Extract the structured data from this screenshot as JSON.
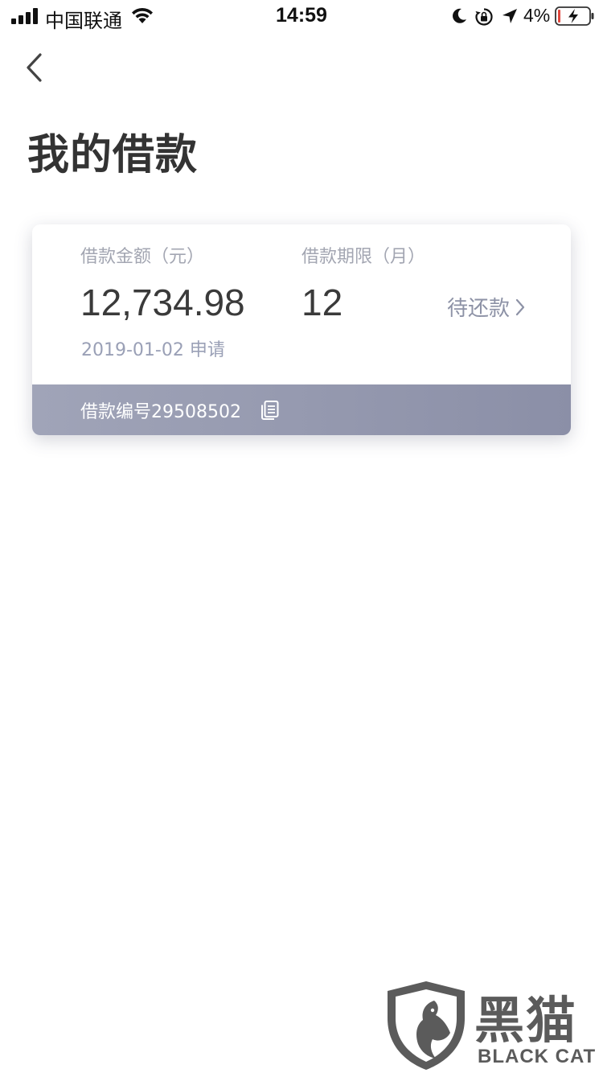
{
  "status_bar": {
    "carrier": "中国联通",
    "time": "14:59",
    "battery_percent": "4%"
  },
  "header": {
    "title": "我的借款"
  },
  "loan_card": {
    "amount_label": "借款金额（元）",
    "amount_value": "12,734.98",
    "term_label": "借款期限（月）",
    "term_value": "12",
    "apply_date": "2019-01-02 申请",
    "status": "待还款",
    "loan_number_label": "借款编号",
    "loan_number": "29508502"
  },
  "watermark": {
    "cn": "黑猫",
    "en": "BLACK CAT"
  },
  "colors": {
    "footer_gradient_start": "#a0a4b8",
    "footer_gradient_end": "#8b8fa7",
    "label": "#a3a6b2",
    "value": "#3a3a3a"
  },
  "icons": {
    "back": "chevron-left-icon",
    "status_arrow": "chevron-right-icon",
    "copy": "copy-icon"
  }
}
